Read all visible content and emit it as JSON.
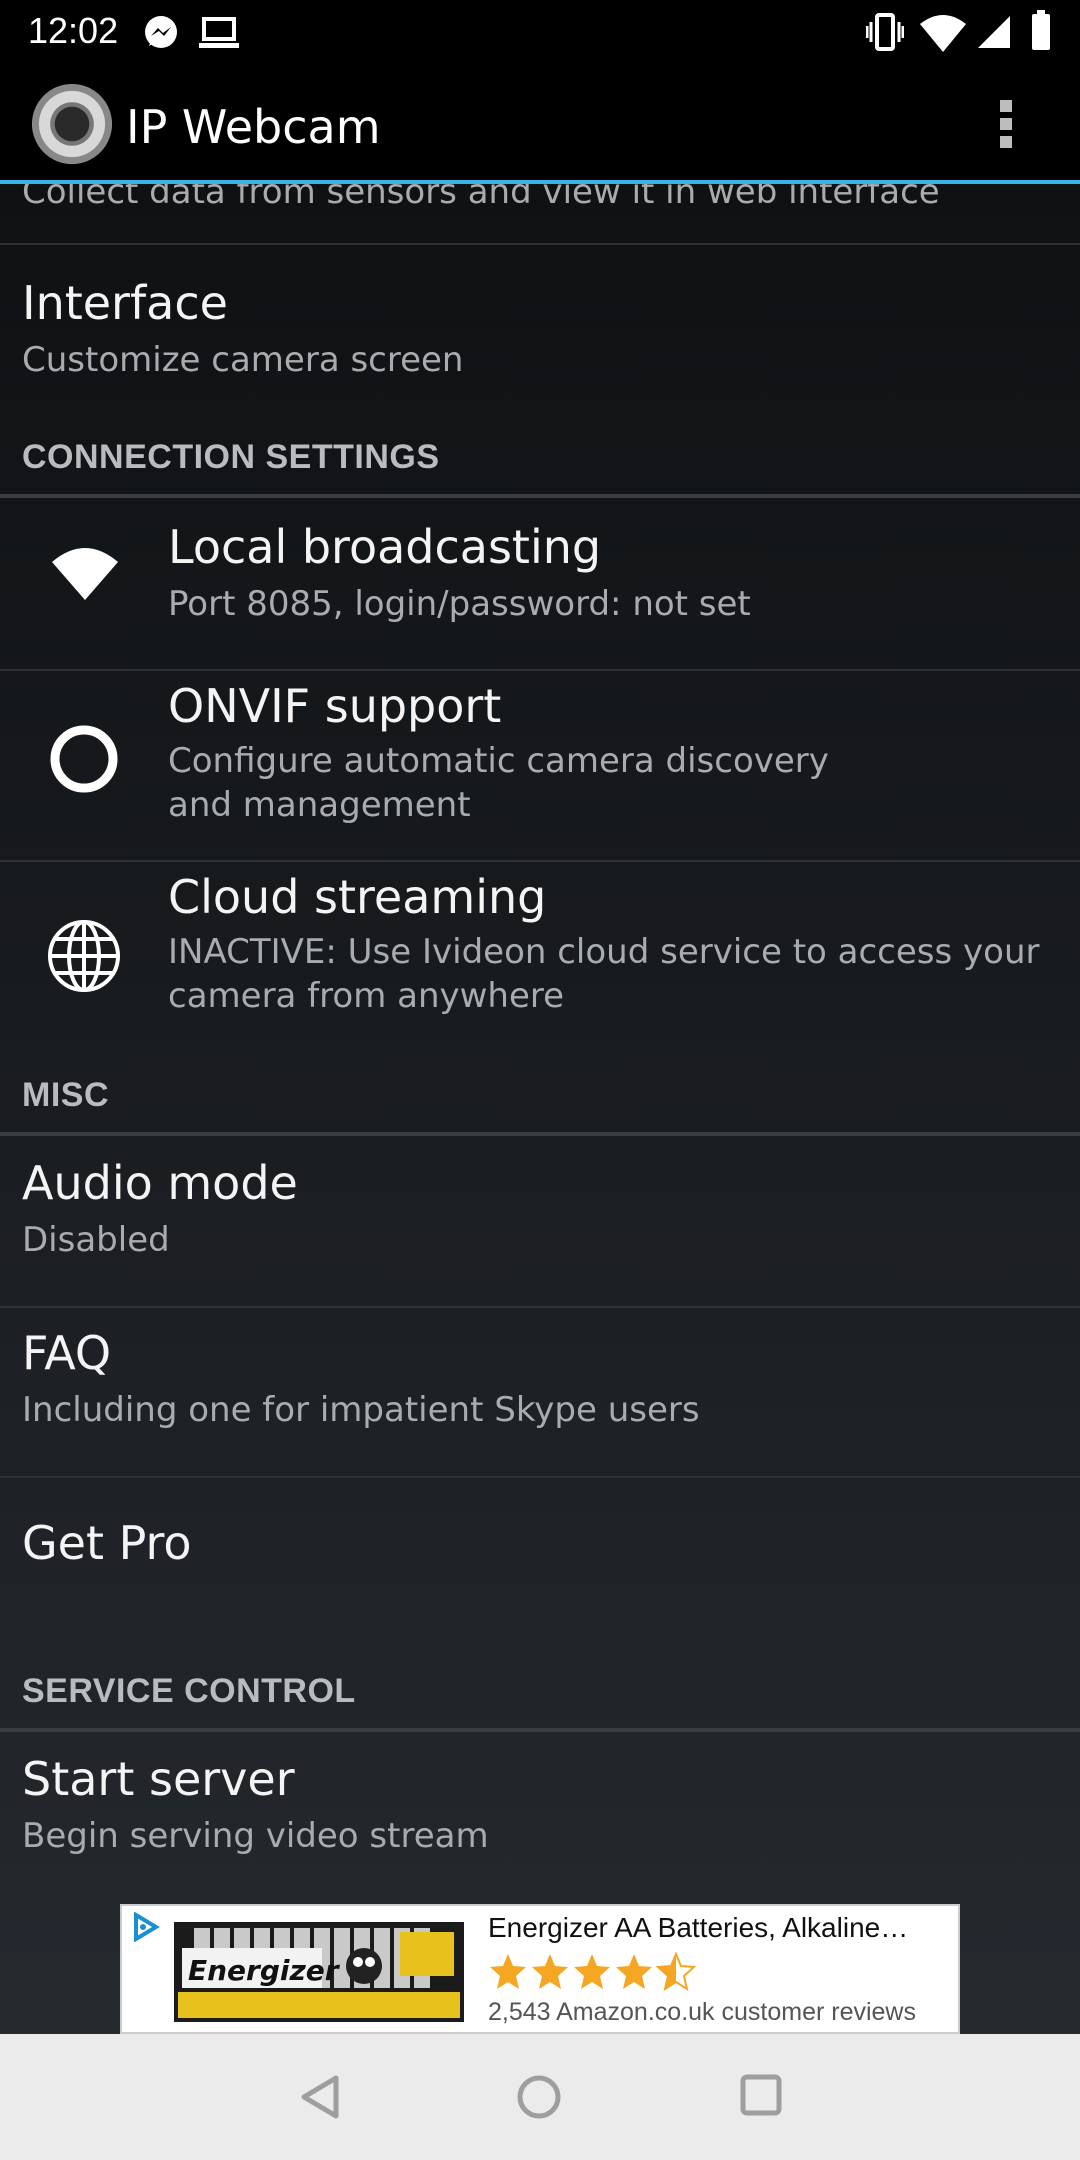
{
  "status_bar": {
    "time": "12:02"
  },
  "app_bar": {
    "title": "IP Webcam"
  },
  "rows": {
    "sensors_sub": "Collect data from sensors and view it in web interface",
    "interface": {
      "title": "Interface",
      "sub": "Customize camera screen"
    }
  },
  "sections": {
    "connection": "CONNECTION SETTINGS",
    "misc": "MISC",
    "service": "SERVICE CONTROL"
  },
  "connection_items": [
    {
      "title": "Local broadcasting",
      "sub": "Port 8085, login/password: not set",
      "icon": "wifi-icon"
    },
    {
      "title": "ONVIF support",
      "sub": "Configure automatic camera discovery and management",
      "icon": "ring-icon"
    },
    {
      "title": "Cloud streaming",
      "sub": "INACTIVE: Use Ivideon cloud service to access your camera from anywhere",
      "icon": "globe-icon"
    }
  ],
  "misc_items": [
    {
      "title": "Audio mode",
      "sub": "Disabled"
    },
    {
      "title": "FAQ",
      "sub": "Including one for impatient Skype users"
    },
    {
      "title": "Get Pro"
    }
  ],
  "service_items": [
    {
      "title": "Start server",
      "sub": "Begin serving video stream"
    }
  ],
  "ad": {
    "title": "Energizer AA Batteries, Alkaline…",
    "rating": 4.5,
    "reviews": "2,543 Amazon.co.uk customer reviews",
    "brand_text": "Energizer",
    "star_color": "#f5a623"
  },
  "colors": {
    "accent": "#33b5e5"
  }
}
